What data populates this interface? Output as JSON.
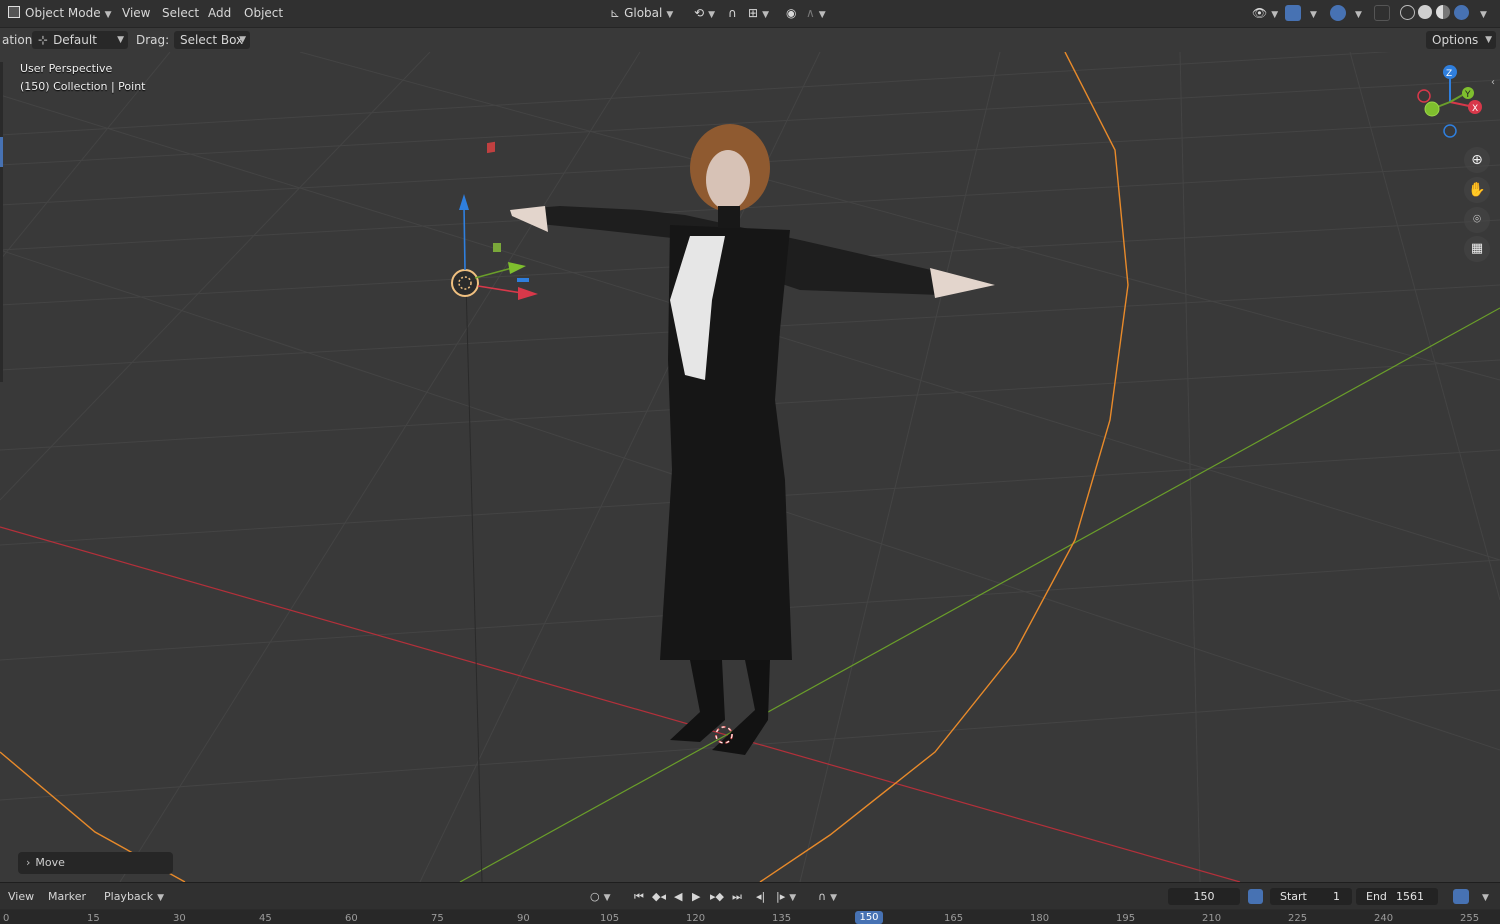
{
  "header": {
    "mode": "Object Mode",
    "menus": [
      "View",
      "Select",
      "Add",
      "Object"
    ],
    "orientation": "Global"
  },
  "tool_settings": {
    "orientation_label": "ation:",
    "orientation_value": "Default",
    "drag_label": "Drag:",
    "drag_value": "Select Box",
    "options": "Options"
  },
  "viewport": {
    "perspective": "User Perspective",
    "collection": "(150) Collection | Point",
    "last_op": "Move"
  },
  "gizmo": {
    "z": "Z",
    "y": "Y",
    "x": "X"
  },
  "timeline": {
    "menus": [
      "View",
      "Marker",
      "Playback"
    ],
    "current_frame": "150",
    "start_label": "Start",
    "start_value": "1",
    "end_label": "End",
    "end_value": "1561",
    "ruler_ticks": [
      "0",
      "15",
      "30",
      "45",
      "60",
      "75",
      "90",
      "105",
      "120",
      "135",
      "150",
      "165",
      "180",
      "195",
      "210",
      "225",
      "240",
      "255"
    ],
    "playhead": "150"
  },
  "colors": {
    "x_axis": "#b4303a",
    "y_axis": "#6a9e2a",
    "z_axis": "#2f7fde",
    "accent": "#4772b3",
    "selection": "#e88a2a"
  }
}
